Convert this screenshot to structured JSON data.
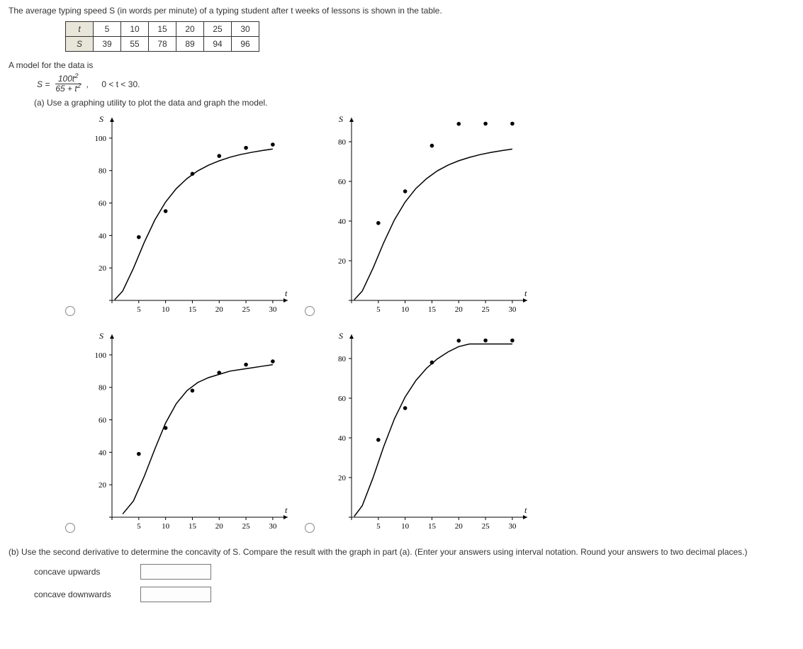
{
  "intro": "The average typing speed S (in words per minute) of a typing student after t weeks of lessons is shown in the table.",
  "table": {
    "row1_hdr": "t",
    "row1": [
      "5",
      "10",
      "15",
      "20",
      "25",
      "30"
    ],
    "row2_hdr": "S",
    "row2": [
      "39",
      "55",
      "78",
      "89",
      "94",
      "96"
    ]
  },
  "model_intro": "A model for the data is",
  "formula": {
    "lhs": "S =",
    "num": "100t",
    "num_exp": "2",
    "den_pre": "65 + t",
    "den_exp": "2",
    "after": ",",
    "domain": "0 < t < 30."
  },
  "part_a": "(a) Use a graphing utility to plot the data and graph the model.",
  "axis": {
    "ylabel": "S",
    "xlabel": "t",
    "xticks": [
      "5",
      "10",
      "15",
      "20",
      "25",
      "30"
    ]
  },
  "chart_data": [
    {
      "id": "g1",
      "type": "line",
      "title": "",
      "xlabel": "t",
      "ylabel": "S",
      "xticks": [
        5,
        10,
        15,
        20,
        25,
        30
      ],
      "yticks": [
        20,
        40,
        60,
        80,
        100
      ],
      "ylim": [
        0,
        110
      ],
      "xlim": [
        0,
        32
      ],
      "data_points": [
        {
          "t": 5,
          "S": 39
        },
        {
          "t": 10,
          "S": 55
        },
        {
          "t": 15,
          "S": 78
        },
        {
          "t": 20,
          "S": 89
        },
        {
          "t": 25,
          "S": 94
        },
        {
          "t": 30,
          "S": 96
        }
      ],
      "curve": [
        {
          "t": 0.5,
          "S": 0.4
        },
        {
          "t": 2,
          "S": 5.8
        },
        {
          "t": 4,
          "S": 19.8
        },
        {
          "t": 6,
          "S": 35.6
        },
        {
          "t": 8,
          "S": 49.6
        },
        {
          "t": 10,
          "S": 60.6
        },
        {
          "t": 12,
          "S": 68.9
        },
        {
          "t": 14,
          "S": 75.1
        },
        {
          "t": 16,
          "S": 79.8
        },
        {
          "t": 18,
          "S": 83.3
        },
        {
          "t": 20,
          "S": 86.0
        },
        {
          "t": 22,
          "S": 88.2
        },
        {
          "t": 24,
          "S": 89.9
        },
        {
          "t": 26,
          "S": 91.2
        },
        {
          "t": 28,
          "S": 92.3
        },
        {
          "t": 30,
          "S": 93.3
        }
      ]
    },
    {
      "id": "g2",
      "type": "line",
      "title": "",
      "xlabel": "t",
      "ylabel": "S",
      "xticks": [
        5,
        10,
        15,
        20,
        25,
        30
      ],
      "yticks": [
        20,
        40,
        60,
        80
      ],
      "ylim": [
        0,
        90
      ],
      "xlim": [
        0,
        32
      ],
      "data_points": [
        {
          "t": 5,
          "S": 39
        },
        {
          "t": 10,
          "S": 55
        },
        {
          "t": 15,
          "S": 78
        },
        {
          "t": 20,
          "S": 89
        },
        {
          "t": 25,
          "S": 94
        },
        {
          "t": 30,
          "S": 96
        }
      ],
      "curve": [
        {
          "t": 0.5,
          "S": 0.3
        },
        {
          "t": 2,
          "S": 4.7
        },
        {
          "t": 4,
          "S": 16.2
        },
        {
          "t": 6,
          "S": 29.1
        },
        {
          "t": 8,
          "S": 40.6
        },
        {
          "t": 10,
          "S": 49.6
        },
        {
          "t": 12,
          "S": 56.4
        },
        {
          "t": 14,
          "S": 61.4
        },
        {
          "t": 16,
          "S": 65.3
        },
        {
          "t": 18,
          "S": 68.2
        },
        {
          "t": 20,
          "S": 70.4
        },
        {
          "t": 22,
          "S": 72.1
        },
        {
          "t": 24,
          "S": 73.5
        },
        {
          "t": 26,
          "S": 74.6
        },
        {
          "t": 28,
          "S": 75.5
        },
        {
          "t": 30,
          "S": 76.3
        }
      ]
    },
    {
      "id": "g3",
      "type": "line",
      "title": "",
      "xlabel": "t",
      "ylabel": "S",
      "xticks": [
        5,
        10,
        15,
        20,
        25,
        30
      ],
      "yticks": [
        20,
        40,
        60,
        80,
        100
      ],
      "ylim": [
        0,
        110
      ],
      "xlim": [
        0,
        32
      ],
      "data_points": [
        {
          "t": 5,
          "S": 39
        },
        {
          "t": 10,
          "S": 55
        },
        {
          "t": 15,
          "S": 78
        },
        {
          "t": 20,
          "S": 89
        },
        {
          "t": 25,
          "S": 94
        },
        {
          "t": 30,
          "S": 96
        }
      ],
      "curve": [
        {
          "t": 2,
          "S": 2
        },
        {
          "t": 4,
          "S": 10
        },
        {
          "t": 6,
          "S": 25
        },
        {
          "t": 8,
          "S": 42
        },
        {
          "t": 10,
          "S": 58
        },
        {
          "t": 12,
          "S": 70
        },
        {
          "t": 14,
          "S": 78
        },
        {
          "t": 16,
          "S": 83
        },
        {
          "t": 18,
          "S": 86
        },
        {
          "t": 20,
          "S": 88
        },
        {
          "t": 22,
          "S": 90
        },
        {
          "t": 24,
          "S": 91
        },
        {
          "t": 26,
          "S": 92
        },
        {
          "t": 28,
          "S": 93
        },
        {
          "t": 30,
          "S": 94
        }
      ]
    },
    {
      "id": "g4",
      "type": "line",
      "title": "",
      "xlabel": "t",
      "ylabel": "S",
      "xticks": [
        5,
        10,
        15,
        20,
        25,
        30
      ],
      "yticks": [
        20,
        40,
        60,
        80
      ],
      "ylim": [
        0,
        90
      ],
      "xlim": [
        0,
        32
      ],
      "data_points": [
        {
          "t": 5,
          "S": 39
        },
        {
          "t": 10,
          "S": 55
        },
        {
          "t": 15,
          "S": 78
        },
        {
          "t": 20,
          "S": 89
        },
        {
          "t": 25,
          "S": 94
        },
        {
          "t": 30,
          "S": 96
        }
      ],
      "curve": [
        {
          "t": 0.5,
          "S": 0.4
        },
        {
          "t": 2,
          "S": 5.8
        },
        {
          "t": 4,
          "S": 19.8
        },
        {
          "t": 6,
          "S": 35.6
        },
        {
          "t": 8,
          "S": 49.6
        },
        {
          "t": 10,
          "S": 60.6
        },
        {
          "t": 12,
          "S": 68.9
        },
        {
          "t": 14,
          "S": 75.1
        },
        {
          "t": 16,
          "S": 79.8
        },
        {
          "t": 18,
          "S": 83.3
        },
        {
          "t": 20,
          "S": 86.0
        },
        {
          "t": 22,
          "S": 88.2
        },
        {
          "t": 24,
          "S": 89.9
        },
        {
          "t": 26,
          "S": 91.2
        },
        {
          "t": 28,
          "S": 92.3
        },
        {
          "t": 30,
          "S": 93.3
        }
      ]
    }
  ],
  "part_b": "(b) Use the second derivative to determine the concavity of S. Compare the result with the graph in part (a). (Enter your answers using interval notation. Round your answers to two decimal places.)",
  "answers": {
    "up_label": "concave upwards",
    "down_label": "concave downwards",
    "up_value": "",
    "down_value": ""
  }
}
